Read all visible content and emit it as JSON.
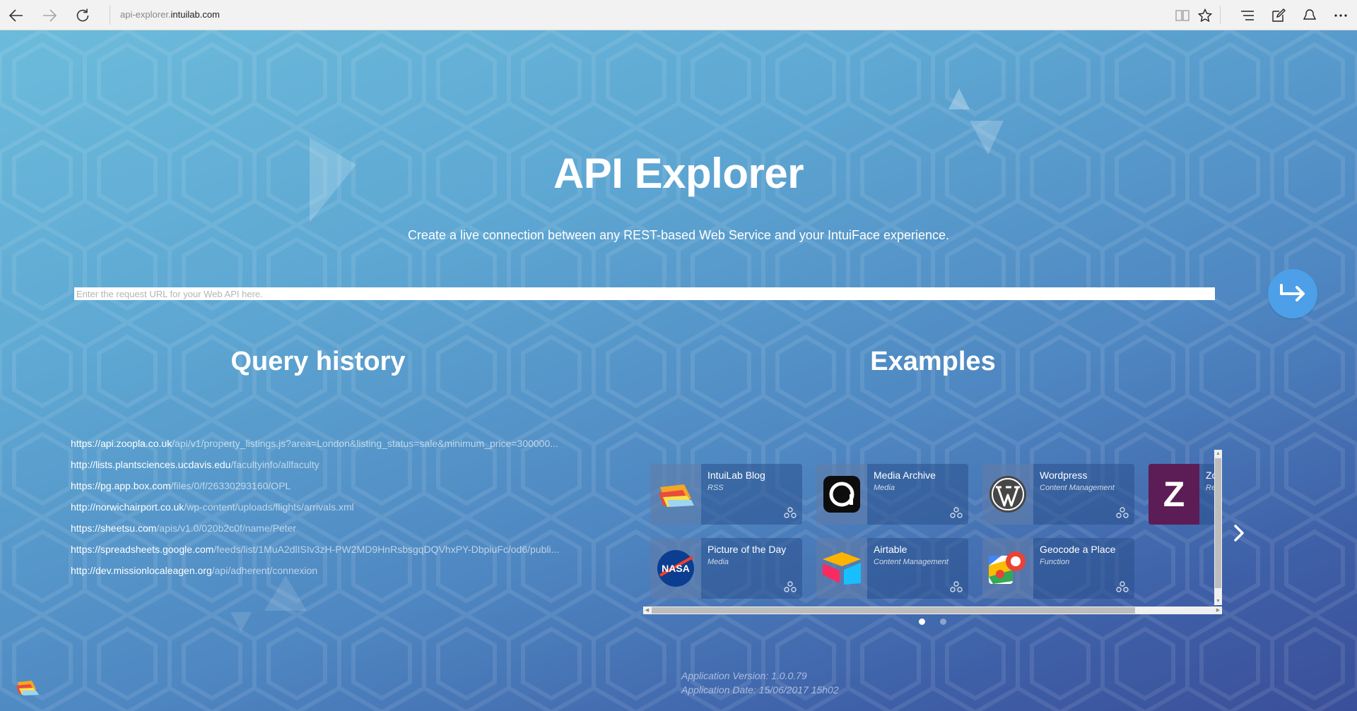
{
  "browser": {
    "back_icon": "back-arrow-icon",
    "forward_icon": "forward-arrow-icon",
    "refresh_icon": "refresh-icon",
    "url_prefix": "api-explorer.",
    "url_domain": "intuilab.com",
    "toolbar_icons": [
      "reading-view-icon",
      "favorite-star-icon",
      "hub-icon",
      "web-note-icon",
      "share-icon",
      "more-icon"
    ]
  },
  "hero": {
    "title": "API Explorer",
    "subtitle": "Create a live connection between any REST-based Web Service and your IntuiFace experience.",
    "url_placeholder": "Enter the request URL for your Web API here.",
    "url_value": "",
    "go_icon": "return-arrow-icon"
  },
  "history": {
    "title": "Query history",
    "items": [
      {
        "host": "https://api.zoopla.co.uk",
        "path": "/api/v1/property_listings.js?area=London&listing_status=sale&minimum_price=300000..."
      },
      {
        "host": "http://lists.plantsciences.ucdavis.edu",
        "path": "/facultyinfo/allfaculty"
      },
      {
        "host": "https://pg.app.box.com",
        "path": "/files/0/f/26330293160/OPL"
      },
      {
        "host": "http://norwichairport.co.uk",
        "path": "/wp-content/uploads/flights/arrivals.xml"
      },
      {
        "host": "https://sheetsu.com",
        "path": "/apis/v1.0/020b2c0f/name/Peter"
      },
      {
        "host": "https://spreadsheets.google.com",
        "path": "/feeds/list/1MuA2dlISIv3zH-PW2MD9HnRsbsgqDQVhxPY-DbpiuFc/od6/publi..."
      },
      {
        "host": "http://dev.missionlocaleagen.org",
        "path": "/api/adherent/connexion"
      }
    ]
  },
  "examples": {
    "title": "Examples",
    "cards": [
      {
        "name": "IntuiLab Blog",
        "category": "RSS",
        "logo": "intuilab-logo-icon",
        "color": "#f5a623"
      },
      {
        "name": "Media Archive",
        "category": "Media",
        "logo": "media-archive-logo-icon",
        "color": "#111111"
      },
      {
        "name": "Wordpress",
        "category": "Content Management",
        "logo": "wordpress-logo-icon",
        "color": "#464646"
      },
      {
        "name": "Zo",
        "category": "Re",
        "logo": "z-logo-icon",
        "color": "#5c1c55"
      },
      {
        "name": "Picture of the Day",
        "category": "Media",
        "logo": "nasa-logo-icon",
        "color": "#0b3d91"
      },
      {
        "name": "Airtable",
        "category": "Content Management",
        "logo": "airtable-logo-icon",
        "color": "#fcb400"
      },
      {
        "name": "Geocode a Place",
        "category": "Function",
        "logo": "google-maps-logo-icon",
        "color": "#ea4335"
      }
    ],
    "badge_icon": "connector-badge-icon",
    "next_icon": "chevron-right-icon",
    "page_count": 2,
    "active_page": 1
  },
  "footer": {
    "version": "Application Version: 1.0.0.79",
    "date": "Application Date: 15/06/2017 15h02"
  }
}
